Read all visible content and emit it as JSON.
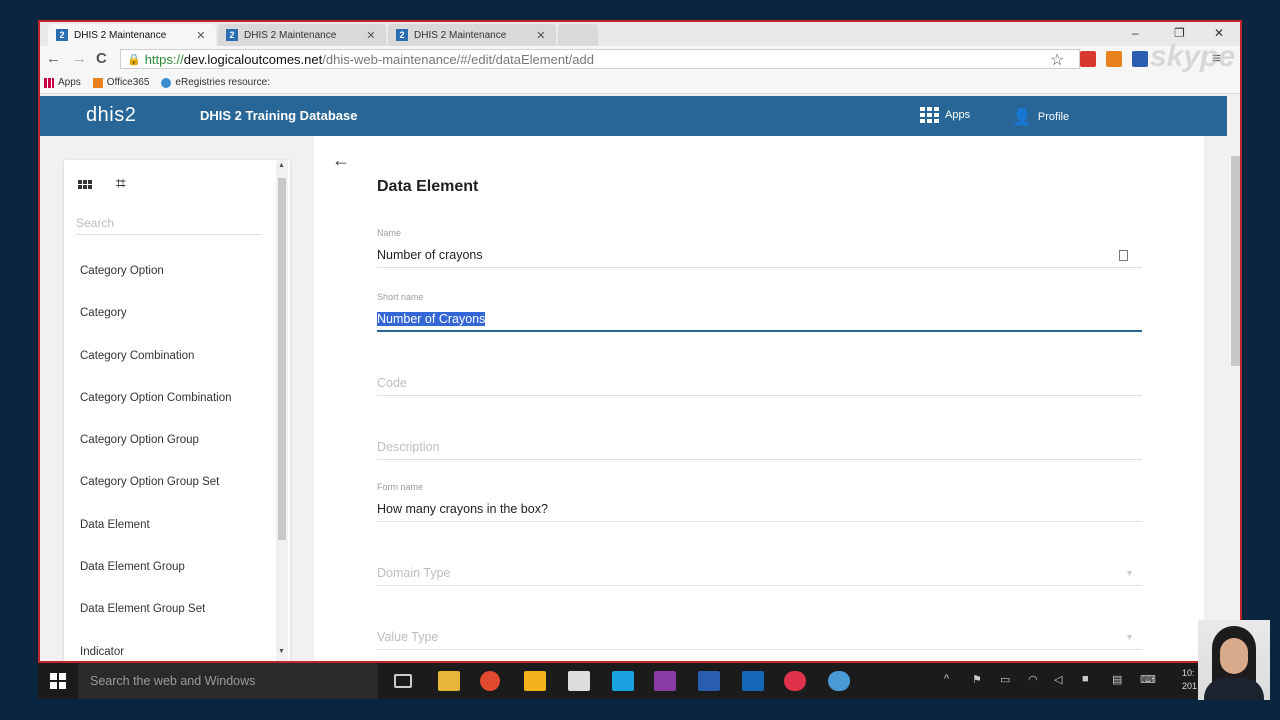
{
  "browser": {
    "tabs": [
      {
        "label": "DHIS 2 Maintenance",
        "active": true
      },
      {
        "label": "DHIS 2 Maintenance",
        "active": false
      },
      {
        "label": "DHIS 2 Maintenance",
        "active": false
      }
    ],
    "url_scheme": "https://",
    "url_host": "dev.logicaloutcomes.net",
    "url_path": "/dhis-web-maintenance/#/edit/dataElement/add",
    "bookmarks": [
      "Apps",
      "Office365",
      "eRegistries resource:"
    ]
  },
  "header": {
    "logo": "dhis2",
    "title": "DHIS 2 Training Database",
    "apps_label": "Apps",
    "profile_label": "Profile",
    "bar_color": "#276696"
  },
  "sidebar": {
    "search_placeholder": "Search",
    "items": [
      "Category Option",
      "Category",
      "Category Combination",
      "Category Option Combination",
      "Category Option Group",
      "Category Option Group Set",
      "Data Element",
      "Data Element Group",
      "Data Element Group Set",
      "Indicator"
    ]
  },
  "form": {
    "heading": "Data Element",
    "name_label": "Name",
    "name_value": "Number of crayons",
    "short_name_label": "Short name",
    "short_name_value": "Number of Crayons",
    "code_placeholder": "Code",
    "description_placeholder": "Description",
    "form_name_label": "Form name",
    "form_name_value": "How many crayons in the box?",
    "domain_type_placeholder": "Domain Type",
    "value_type_placeholder": "Value Type"
  },
  "taskbar": {
    "search_placeholder": "Search the web and Windows",
    "clock_line1": "10:",
    "clock_line2": "201"
  },
  "overlay": {
    "skype_watermark": "skype"
  }
}
